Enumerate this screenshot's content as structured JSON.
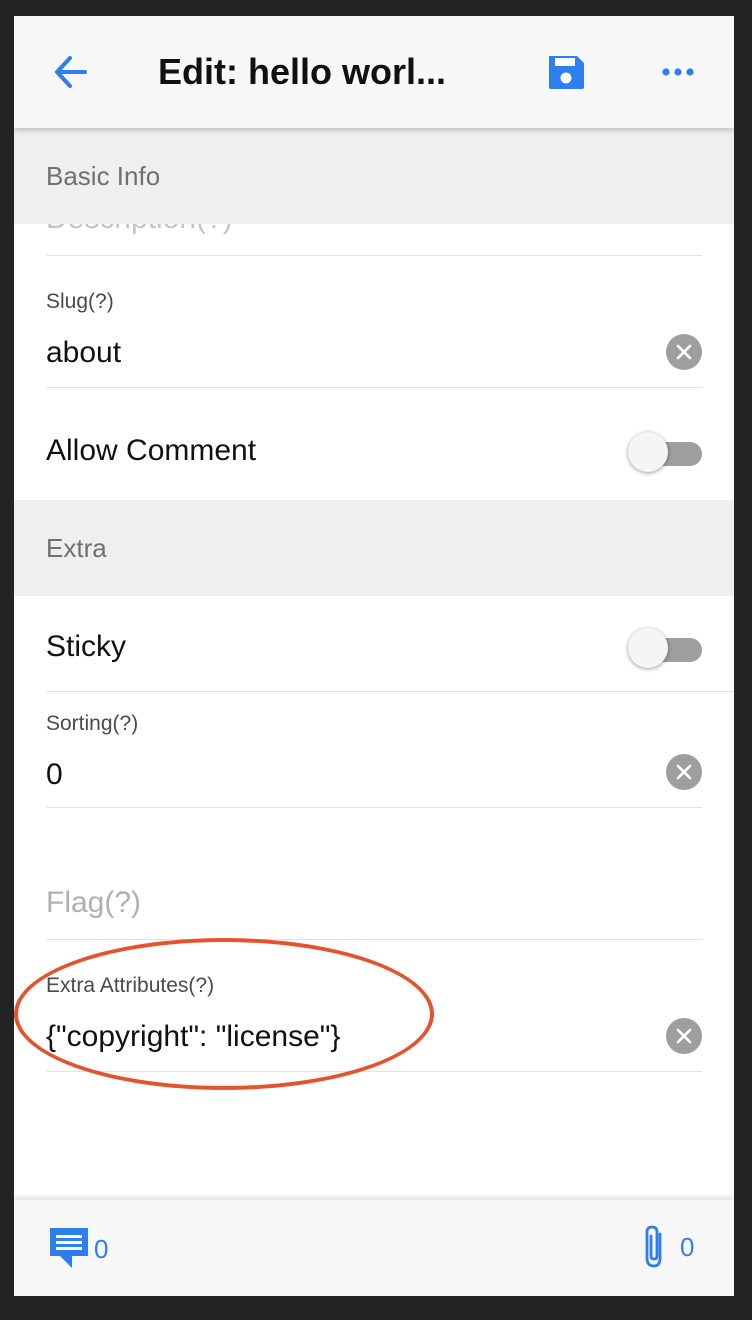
{
  "header": {
    "back_icon": "arrow-left-icon",
    "title": "Edit: hello worl...",
    "save_icon": "floppy-disk-icon",
    "more_icon": "more-horizontal-icon",
    "accent_color": "#2d7ff0"
  },
  "sections": {
    "basic_info": "Basic Info",
    "extra": "Extra"
  },
  "fields": {
    "description_label": "Description(?)",
    "slug": {
      "label": "Slug(?)",
      "value": "about"
    },
    "allow_comment": {
      "label": "Allow Comment",
      "enabled": false
    },
    "sticky": {
      "label": "Sticky",
      "enabled": false
    },
    "sorting": {
      "label": "Sorting(?)",
      "value": "0"
    },
    "flag": {
      "placeholder": "Flag(?)"
    },
    "extra_attributes": {
      "label": "Extra Attributes(?)",
      "value": "{\"copyright\": \"license\"}"
    }
  },
  "annotation": {
    "color": "#e5532e",
    "shape": "ellipse"
  },
  "footer": {
    "comments_icon": "comment-icon",
    "comments_count": "0",
    "attachments_icon": "paperclip-icon",
    "attachments_count": "0"
  }
}
